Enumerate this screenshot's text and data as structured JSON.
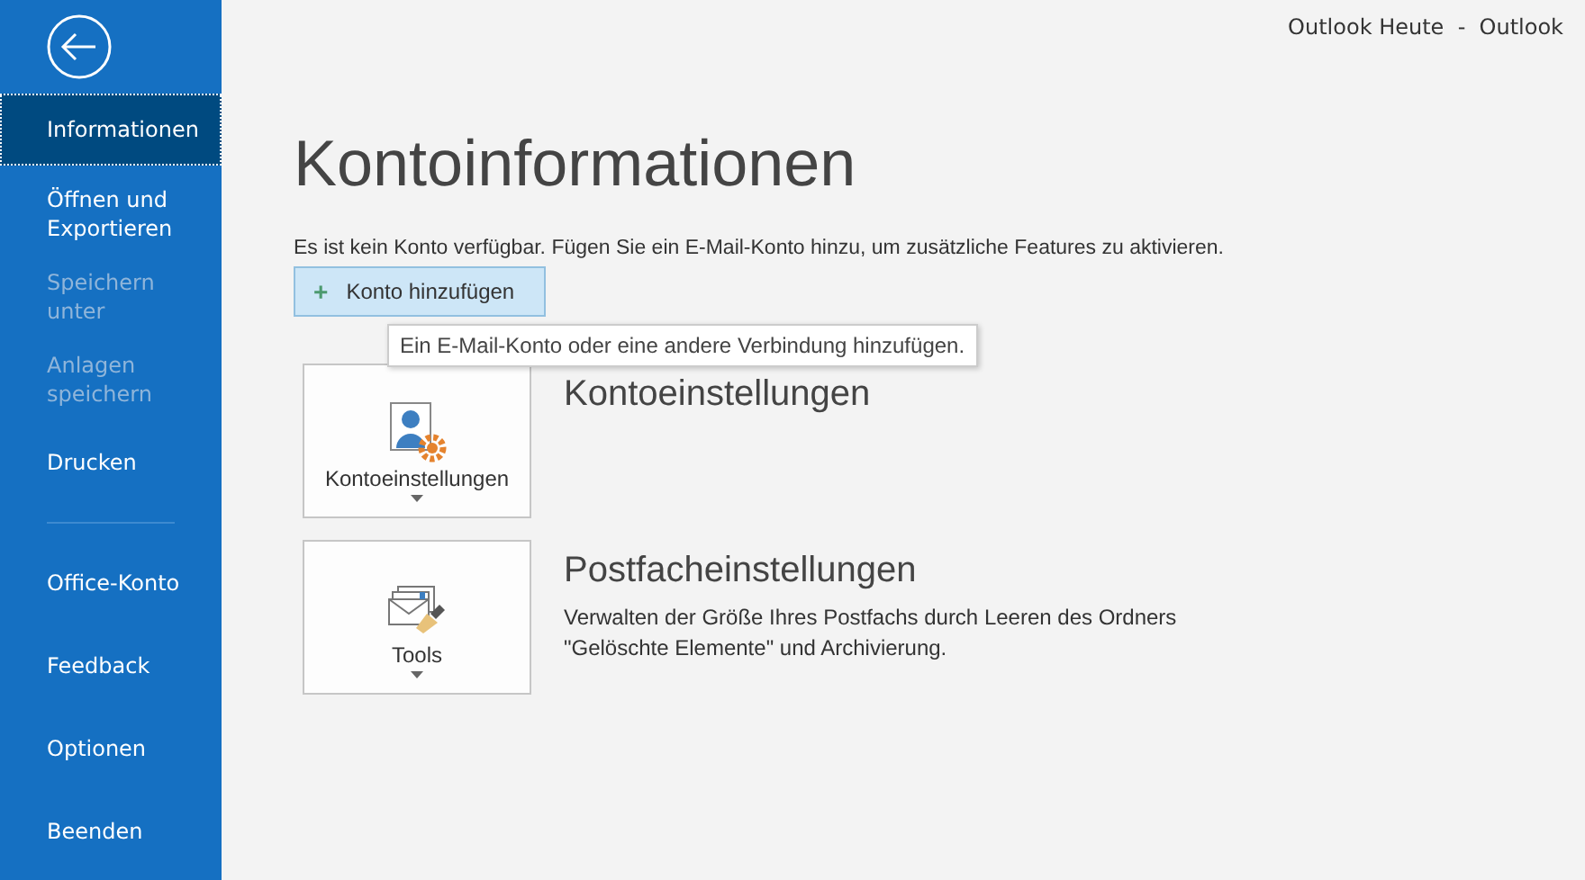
{
  "window": {
    "title": "Outlook Heute  -  Outlook"
  },
  "sidebar": {
    "items": [
      {
        "label": "Informationen",
        "selected": true,
        "disabled": false
      },
      {
        "label": "Öffnen und Exportieren",
        "selected": false,
        "disabled": false
      },
      {
        "label": "Speichern unter",
        "selected": false,
        "disabled": true
      },
      {
        "label": "Anlagen speichern",
        "selected": false,
        "disabled": true
      },
      {
        "label": "Drucken",
        "selected": false,
        "disabled": false
      },
      {
        "kind": "divider"
      },
      {
        "label": "Office-Konto",
        "selected": false,
        "disabled": false
      },
      {
        "label": "Feedback",
        "selected": false,
        "disabled": false
      },
      {
        "label": "Optionen",
        "selected": false,
        "disabled": false
      },
      {
        "label": "Beenden",
        "selected": false,
        "disabled": false
      }
    ]
  },
  "page": {
    "title": "Kontoinformationen",
    "description": "Es ist kein Konto verfügbar. Fügen Sie ein E-Mail-Konto hinzu, um zusätzliche Features zu aktivieren.",
    "add_button": {
      "label": "Konto hinzufügen",
      "icon": "+"
    },
    "tooltip": "Ein E-Mail-Konto oder eine andere Verbindung hinzufügen.",
    "sections": [
      {
        "kind": "account",
        "button": "Kontoeinstellungen",
        "heading": "Kontoeinstellungen"
      },
      {
        "kind": "tools",
        "button": "Tools",
        "heading": "Postfacheinstellungen",
        "description": "Verwalten der Größe Ihres Postfachs durch Leeren des Ordners \"Gelöschte Elemente\" und Archivierung."
      }
    ]
  }
}
